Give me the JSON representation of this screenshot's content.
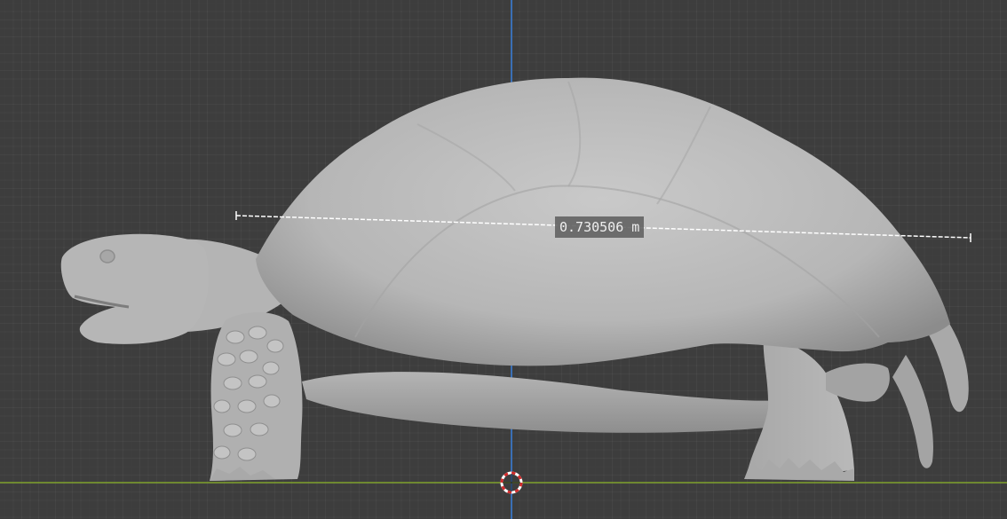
{
  "viewport": {
    "background_color": "#3d3d3d",
    "grid_color": "#474747",
    "axis_x_color": "#7ea12b",
    "axis_z_color": "#3a6fb5"
  },
  "measurement": {
    "label": "0.730506 m",
    "line_color": "#ffffff"
  },
  "model": {
    "icon": "tortoise-mesh",
    "color": "#b9b9b9"
  },
  "cursor": {
    "icon": "3d-cursor-icon"
  }
}
